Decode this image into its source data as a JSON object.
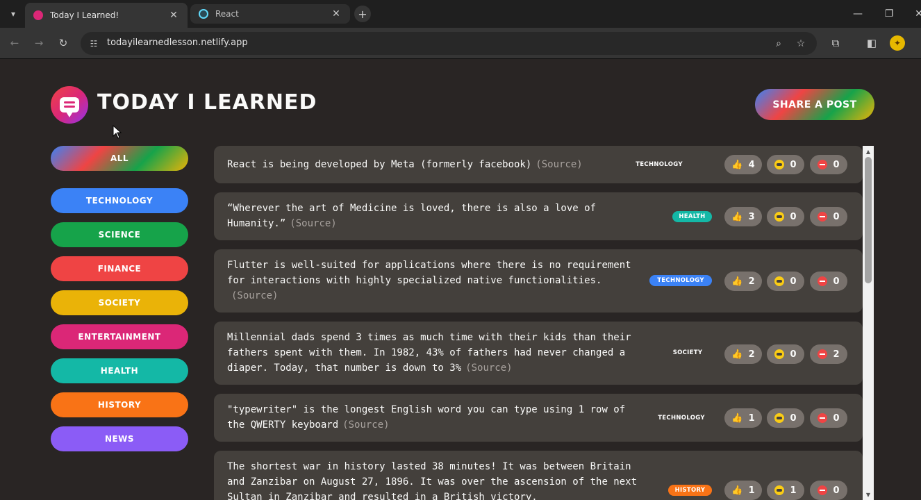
{
  "browser": {
    "tabs": [
      {
        "title": "Today I Learned!",
        "favicon_color": "#db2777"
      },
      {
        "title": "React",
        "favicon_color": "#61dafb"
      }
    ],
    "url": "todayilearnedlesson.netlify.app",
    "avatar_letter": "✦"
  },
  "app": {
    "title": "TODAY I LEARNED",
    "share_label": "SHARE A POST"
  },
  "categories": [
    {
      "label": "ALL",
      "color": "gradient"
    },
    {
      "label": "TECHNOLOGY",
      "color": "#3b82f6"
    },
    {
      "label": "SCIENCE",
      "color": "#16a34a"
    },
    {
      "label": "FINANCE",
      "color": "#ef4444"
    },
    {
      "label": "SOCIETY",
      "color": "#eab308"
    },
    {
      "label": "ENTERTAINMENT",
      "color": "#db2777"
    },
    {
      "label": "HEALTH",
      "color": "#14b8a6"
    },
    {
      "label": "HISTORY",
      "color": "#f97316"
    },
    {
      "label": "NEWS",
      "color": "#8b5cf6"
    }
  ],
  "facts": [
    {
      "text": "React is being developed by Meta (formerly facebook)",
      "source": "(Source)",
      "tag": "TECHNOLOGY",
      "tag_color": "transparent",
      "votes": {
        "interesting": 4,
        "mindblowing": 0,
        "false": 0
      }
    },
    {
      "text": "“Wherever the art of Medicine is loved, there is also a love of Humanity.”",
      "source": "(Source)",
      "tag": "HEALTH",
      "tag_color": "#14b8a6",
      "votes": {
        "interesting": 3,
        "mindblowing": 0,
        "false": 0
      }
    },
    {
      "text": "Flutter is well-suited for applications where there is no requirement for interactions with highly specialized native functionalities.",
      "source": "(Source)",
      "tag": "TECHNOLOGY",
      "tag_color": "#3b82f6",
      "votes": {
        "interesting": 2,
        "mindblowing": 0,
        "false": 0
      }
    },
    {
      "text": "Millennial dads spend 3 times as much time with their kids than their fathers spent with them. In 1982, 43% of fathers had never changed a diaper. Today, that number is down to 3%",
      "source": "(Source)",
      "tag": "SOCIETY",
      "tag_color": "transparent",
      "votes": {
        "interesting": 2,
        "mindblowing": 0,
        "false": 2
      }
    },
    {
      "text": "\"typewriter\" is the longest English word you can type using 1 row of the QWERTY keyboard",
      "source": "(Source)",
      "tag": "TECHNOLOGY",
      "tag_color": "transparent",
      "votes": {
        "interesting": 1,
        "mindblowing": 0,
        "false": 0
      }
    },
    {
      "text": "The shortest war in history lasted 38 minutes! It was between Britain and Zanzibar on August 27, 1896. It was over the ascension of the next Sultan in Zanzibar and resulted in a British victory.",
      "source": "",
      "tag": "HISTORY",
      "tag_color": "#f97316",
      "votes": {
        "interesting": 1,
        "mindblowing": 1,
        "false": 0
      }
    }
  ]
}
